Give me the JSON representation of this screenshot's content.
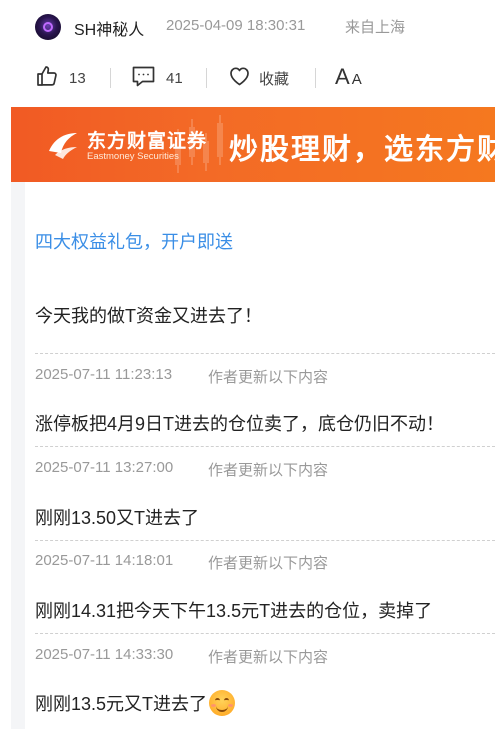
{
  "author": {
    "name": "SH神秘人",
    "post_time": "2025-04-09 18:30:31",
    "location": "来自上海"
  },
  "actions": {
    "like_count": "13",
    "comment_count": "41",
    "favorite_label": "收藏",
    "font_big": "A",
    "font_small": "A"
  },
  "banner": {
    "brand_cn": "东方财富证券",
    "brand_en": "Eastmoney Securities",
    "slogan": "炒股理财，选东方财"
  },
  "promo_link": "四大权益礼包，开户即送",
  "intro_text": "今天我的做T资金又进去了！",
  "updates": [
    {
      "time": "2025-07-11 11:23:13",
      "note": "作者更新以下内容",
      "text": "涨停板把4月9日T进去的仓位卖了，底仓仍旧不动！"
    },
    {
      "time": "2025-07-11 13:27:00",
      "note": "作者更新以下内容",
      "text": "刚刚13.50又T进去了"
    },
    {
      "time": "2025-07-11 14:18:01",
      "note": "作者更新以下内容",
      "text": "刚刚14.31把今天下午13.5元T进去的仓位，卖掉了"
    },
    {
      "time": "2025-07-11 14:33:30",
      "note": "作者更新以下内容",
      "text": "刚刚13.5元又T进去了"
    }
  ],
  "icons": {
    "like": "thumbs-up-icon",
    "comment": "comment-icon",
    "favorite": "heart-icon",
    "emoji": "smiling-face-emoji"
  },
  "colors": {
    "link": "#3a8ee6",
    "banner": "#f15a24",
    "muted": "#999999"
  }
}
